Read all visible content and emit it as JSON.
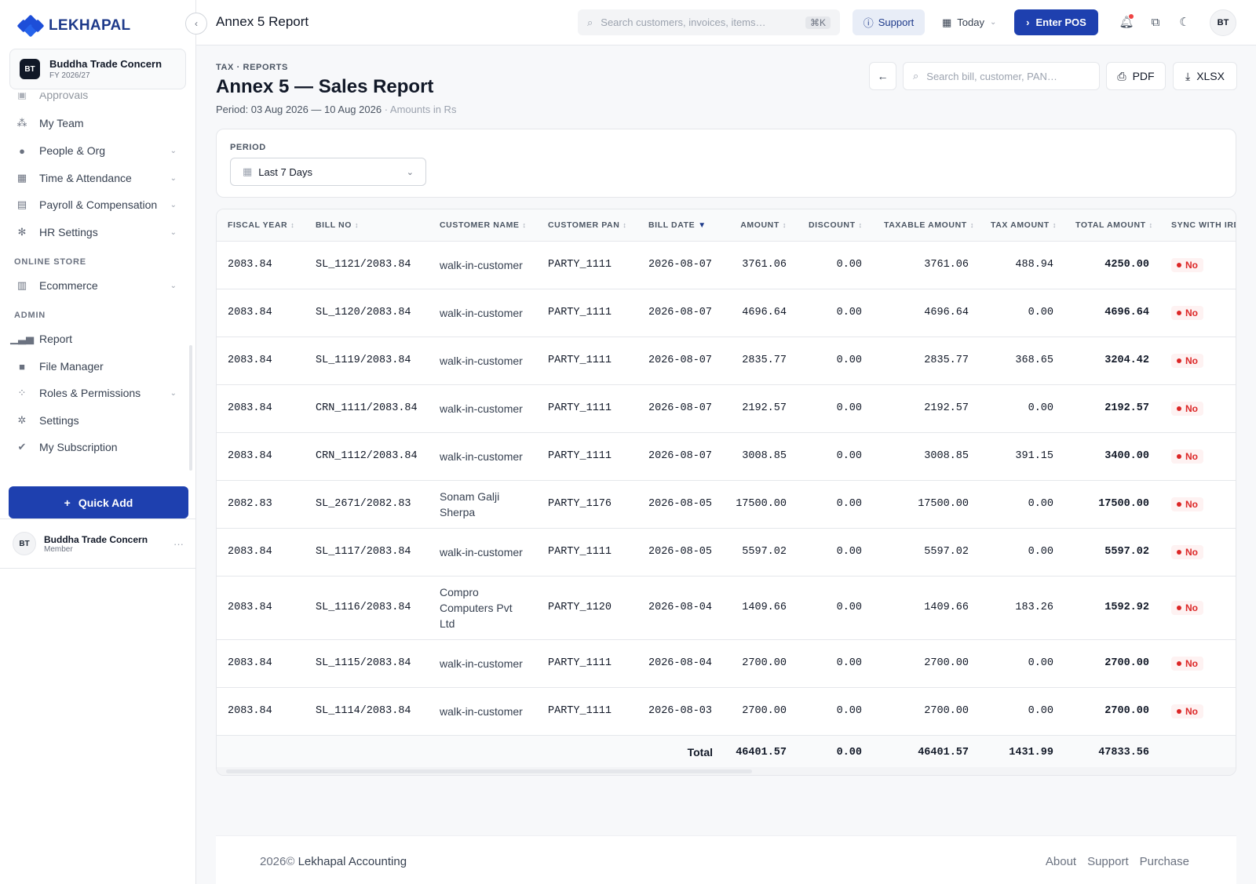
{
  "app": {
    "brand": "LEKHAPAL"
  },
  "org": {
    "initials": "BT",
    "name": "Buddha Trade Concern",
    "fy": "FY 2026/27"
  },
  "sidebar": {
    "items": [
      {
        "label": "Approvals",
        "icon": "approvals-icon",
        "chevron": false
      },
      {
        "label": "My Team",
        "icon": "team-icon",
        "chevron": false
      },
      {
        "label": "People & Org",
        "icon": "people-icon",
        "chevron": true
      },
      {
        "label": "Time & Attendance",
        "icon": "calendar-icon",
        "chevron": true
      },
      {
        "label": "Payroll & Compensation",
        "icon": "payroll-icon",
        "chevron": true
      },
      {
        "label": "HR Settings",
        "icon": "gear-icon",
        "chevron": true
      }
    ],
    "online_store_label": "ONLINE STORE",
    "online_store_items": [
      {
        "label": "Ecommerce",
        "icon": "store-icon",
        "chevron": true
      }
    ],
    "admin_label": "ADMIN",
    "admin_items": [
      {
        "label": "Report",
        "icon": "bar-chart-icon",
        "chevron": false
      },
      {
        "label": "File Manager",
        "icon": "folder-icon",
        "chevron": false
      },
      {
        "label": "Roles & Permissions",
        "icon": "roles-icon",
        "chevron": true
      },
      {
        "label": "Settings",
        "icon": "settings-icon",
        "chevron": false
      },
      {
        "label": "My Subscription",
        "icon": "badge-check-icon",
        "chevron": false
      }
    ],
    "quick_add": "Quick Add"
  },
  "user": {
    "initials": "BT",
    "name": "Buddha Trade Concern",
    "role": "Member"
  },
  "header": {
    "title": "Annex 5 Report",
    "search_placeholder": "Search customers, invoices, items…",
    "search_shortcut": "⌘K",
    "support": "Support",
    "date_range": "Today",
    "enter_pos": "Enter POS",
    "avatar": "BT"
  },
  "report": {
    "breadcrumb": "TAX · REPORTS",
    "title": "Annex 5 — Sales Report",
    "period_text": "Period: 03 Aug 2026 — 10 Aug 2026",
    "amounts_note": "· Amounts in Rs",
    "bill_search_placeholder": "Search bill, customer, PAN…",
    "pdf": "PDF",
    "xlsx": "XLSX",
    "period_label": "PERIOD",
    "period_value": "Last 7 Days"
  },
  "table": {
    "columns": [
      "FISCAL YEAR",
      "BILL NO",
      "CUSTOMER NAME",
      "CUSTOMER PAN",
      "BILL DATE",
      "AMOUNT",
      "DISCOUNT",
      "TAXABLE AMOUNT",
      "TAX AMOUNT",
      "TOTAL AMOUNT",
      "SYNC WITH IRD"
    ],
    "rows": [
      {
        "fy": "2083.84",
        "bill": "SL_1121/2083.84",
        "customer": "walk-in-customer",
        "pan": "PARTY_1111",
        "date": "2026-08-07",
        "amount": "3761.06",
        "discount": "0.00",
        "taxable": "3761.06",
        "tax": "488.94",
        "total": "4250.00",
        "sync": "No"
      },
      {
        "fy": "2083.84",
        "bill": "SL_1120/2083.84",
        "customer": "walk-in-customer",
        "pan": "PARTY_1111",
        "date": "2026-08-07",
        "amount": "4696.64",
        "discount": "0.00",
        "taxable": "4696.64",
        "tax": "0.00",
        "total": "4696.64",
        "sync": "No"
      },
      {
        "fy": "2083.84",
        "bill": "SL_1119/2083.84",
        "customer": "walk-in-customer",
        "pan": "PARTY_1111",
        "date": "2026-08-07",
        "amount": "2835.77",
        "discount": "0.00",
        "taxable": "2835.77",
        "tax": "368.65",
        "total": "3204.42",
        "sync": "No"
      },
      {
        "fy": "2083.84",
        "bill": "CRN_1111/2083.84",
        "customer": "walk-in-customer",
        "pan": "PARTY_1111",
        "date": "2026-08-07",
        "amount": "2192.57",
        "discount": "0.00",
        "taxable": "2192.57",
        "tax": "0.00",
        "total": "2192.57",
        "sync": "No"
      },
      {
        "fy": "2083.84",
        "bill": "CRN_1112/2083.84",
        "customer": "walk-in-customer",
        "pan": "PARTY_1111",
        "date": "2026-08-07",
        "amount": "3008.85",
        "discount": "0.00",
        "taxable": "3008.85",
        "tax": "391.15",
        "total": "3400.00",
        "sync": "No"
      },
      {
        "fy": "2082.83",
        "bill": "SL_2671/2082.83",
        "customer": "Sonam Galji Sherpa",
        "pan": "PARTY_1176",
        "date": "2026-08-05",
        "amount": "17500.00",
        "discount": "0.00",
        "taxable": "17500.00",
        "tax": "0.00",
        "total": "17500.00",
        "sync": "No"
      },
      {
        "fy": "2083.84",
        "bill": "SL_1117/2083.84",
        "customer": "walk-in-customer",
        "pan": "PARTY_1111",
        "date": "2026-08-05",
        "amount": "5597.02",
        "discount": "0.00",
        "taxable": "5597.02",
        "tax": "0.00",
        "total": "5597.02",
        "sync": "No"
      },
      {
        "fy": "2083.84",
        "bill": "SL_1116/2083.84",
        "customer": "Compro Computers Pvt Ltd",
        "pan": "PARTY_1120",
        "date": "2026-08-04",
        "amount": "1409.66",
        "discount": "0.00",
        "taxable": "1409.66",
        "tax": "183.26",
        "total": "1592.92",
        "sync": "No"
      },
      {
        "fy": "2083.84",
        "bill": "SL_1115/2083.84",
        "customer": "walk-in-customer",
        "pan": "PARTY_1111",
        "date": "2026-08-04",
        "amount": "2700.00",
        "discount": "0.00",
        "taxable": "2700.00",
        "tax": "0.00",
        "total": "2700.00",
        "sync": "No"
      },
      {
        "fy": "2083.84",
        "bill": "SL_1114/2083.84",
        "customer": "walk-in-customer",
        "pan": "PARTY_1111",
        "date": "2026-08-03",
        "amount": "2700.00",
        "discount": "0.00",
        "taxable": "2700.00",
        "tax": "0.00",
        "total": "2700.00",
        "sync": "No"
      }
    ],
    "totals": {
      "label": "Total",
      "amount": "46401.57",
      "discount": "0.00",
      "taxable": "46401.57",
      "tax": "1431.99",
      "total": "47833.56"
    }
  },
  "footer": {
    "year": "2026©",
    "company": "Lekhapal Accounting",
    "links": [
      "About",
      "Support",
      "Purchase"
    ]
  },
  "colors": {
    "primary": "#1e40af",
    "danger": "#dc2626",
    "border": "#e5e7eb"
  }
}
